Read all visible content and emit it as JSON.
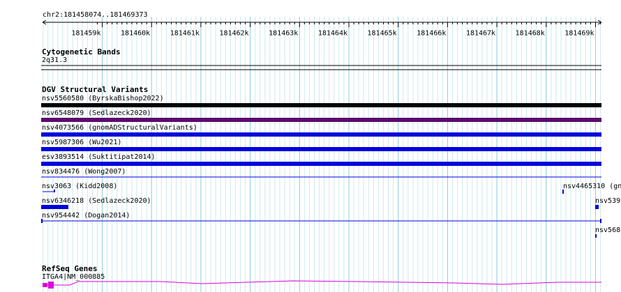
{
  "ruler": {
    "location": "chr2:181458074..181469373",
    "ticks": [
      "181459k",
      "181460k",
      "181461k",
      "181462k",
      "181463k",
      "181464k",
      "181465k",
      "181466k",
      "181467k",
      "181468k",
      "181469k"
    ]
  },
  "tracks": {
    "cyto": {
      "title": "Cytogenetic Bands",
      "band": "2q31.3"
    },
    "dgv": {
      "title": "DGV Structural Variants",
      "features": [
        {
          "label": "nsv5560580 (ByrskaBishop2022)",
          "color": "#000000"
        },
        {
          "label": "nsv6548079 (Sedlazeck2020)",
          "color": "#5c0a6e"
        },
        {
          "label": "nsv4073566 (gnomADStructuralVariants)",
          "color": "#0000dd"
        },
        {
          "label": "nsv5987306 (Wu2021)",
          "color": "#0000dd"
        },
        {
          "label": "esv3893514 (Suktitipat2014)",
          "color": "#0000dd"
        },
        {
          "label": "nsv834476 (Wong2007)",
          "color": "#0000dd"
        },
        {
          "label": "nsv3063 (Kidd2008)",
          "color": "#0000dd"
        },
        {
          "label": "nsv4465310 (gn",
          "color": "#0000dd"
        },
        {
          "label": "nsv6346218 (Sedlazeck2020)",
          "color": "#0000dd"
        },
        {
          "label": "nsv539",
          "color": "#0000dd"
        },
        {
          "label": "nsv954442 (Dogan2014)",
          "color": "#0000dd"
        },
        {
          "label": "nsv568",
          "color": "#0000dd"
        }
      ]
    },
    "refseq": {
      "title": "RefSeq Genes",
      "gene": "ITGA4|NM_000885",
      "color": "#dd00dd"
    }
  },
  "colors": {
    "grid_major": "#8fd0dc",
    "grid_minor": "#cde9ee",
    "text": "#000000"
  }
}
